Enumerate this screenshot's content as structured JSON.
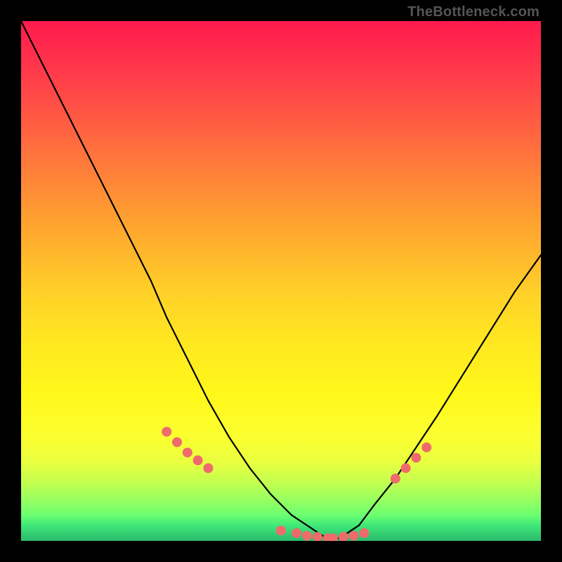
{
  "attribution": "TheBottleneck.com",
  "chart_data": {
    "type": "line",
    "title": "",
    "xlabel": "",
    "ylabel": "",
    "xlim": [
      0,
      100
    ],
    "ylim": [
      0,
      100
    ],
    "series": [
      {
        "name": "bottleneck-curve",
        "x": [
          0,
          5,
          10,
          15,
          20,
          25,
          28,
          32,
          36,
          40,
          44,
          48,
          52,
          55,
          58,
          60,
          62,
          65,
          68,
          72,
          76,
          80,
          85,
          90,
          95,
          100
        ],
        "values": [
          100,
          90,
          80,
          70,
          60,
          50,
          43,
          35,
          27,
          20,
          14,
          9,
          5,
          3,
          1,
          0,
          1,
          3,
          7,
          12,
          18,
          24,
          32,
          40,
          48,
          55
        ]
      }
    ],
    "markers": {
      "name": "highlighted-points",
      "color": "#ef6b6b",
      "x": [
        28,
        30,
        32,
        34,
        36,
        50,
        53,
        55,
        57,
        59,
        60,
        62,
        64,
        66,
        72,
        74,
        76,
        78
      ],
      "values": [
        21,
        19,
        17,
        15.5,
        14,
        2,
        1.5,
        1,
        0.8,
        0.5,
        0.5,
        0.8,
        1,
        1.5,
        12,
        14,
        16,
        18
      ]
    },
    "gradient_stops": [
      {
        "pos": 0.0,
        "color": "#ff1a4d"
      },
      {
        "pos": 0.5,
        "color": "#ffd028"
      },
      {
        "pos": 0.8,
        "color": "#fff81a"
      },
      {
        "pos": 1.0,
        "color": "#2ab86c"
      }
    ]
  }
}
